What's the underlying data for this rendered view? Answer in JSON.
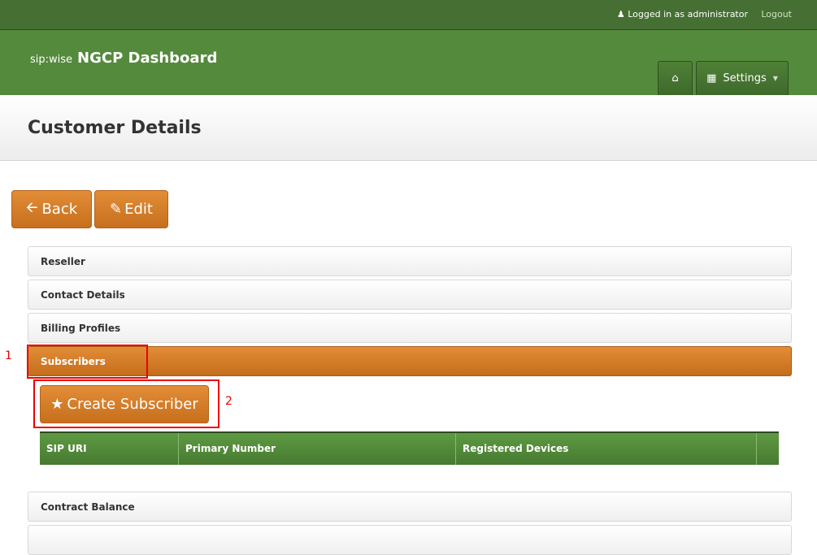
{
  "topbar": {
    "user_text": "Logged in as administrator",
    "logout": "Logout"
  },
  "header": {
    "logo_small": "sip:wise",
    "app_title": "NGCP Dashboard",
    "settings": "Settings"
  },
  "page": {
    "title": "Customer Details",
    "back": "Back",
    "edit": "Edit"
  },
  "sections": [
    "Reseller",
    "Contact Details",
    "Billing Profiles",
    "Subscribers"
  ],
  "subscribers": {
    "create": "Create Subscriber",
    "columns": [
      "SIP URI",
      "Primary Number",
      "Registered Devices",
      ""
    ]
  },
  "sections_after": [
    "Contract Balance"
  ],
  "annotations": [
    "1",
    "2"
  ]
}
